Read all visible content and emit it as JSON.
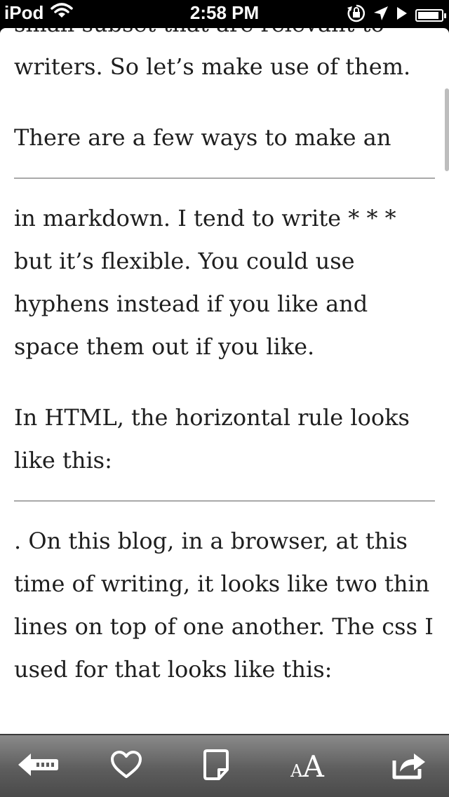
{
  "status_bar": {
    "carrier": "iPod",
    "time": "2:58 PM",
    "battery_level": 0.9,
    "icons": [
      "wifi-icon",
      "orientation-lock-icon",
      "location-arrow-icon",
      "play-icon",
      "battery-icon"
    ]
  },
  "article": {
    "paragraphs": [
      "small subset that are relevant to writers. So let’s make use of them.",
      "There are a few ways to make an",
      "in markdown. I tend to write *   * * but it’s flexible. You could use hyphens instead if you like and space them out if you like.",
      "In HTML, the horizontal rule looks like this:",
      ". On this blog, in a browser, at this time of writing, it looks like two thin lines on top of one another. The css I used for that looks like this:"
    ]
  },
  "toolbar": {
    "buttons": [
      "back-icon",
      "heart-icon",
      "note-icon",
      "font-size-icon",
      "share-icon"
    ],
    "font_size_small": "A",
    "font_size_large": "A"
  },
  "colors": {
    "text": "#1e1e1e",
    "rule": "#a9a9a9",
    "toolbar_top": "#8a8a8a",
    "toolbar_bottom": "#4a4a4a"
  }
}
